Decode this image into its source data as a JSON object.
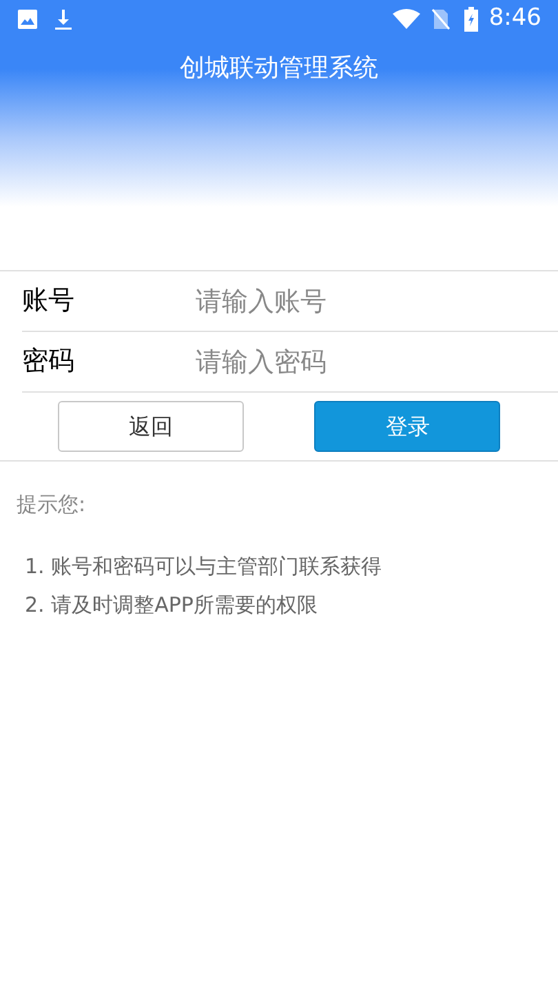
{
  "status_bar": {
    "time": "8:46"
  },
  "header": {
    "title": "创城联动管理系统"
  },
  "form": {
    "fields": [
      {
        "label": "账号",
        "placeholder": "请输入账号"
      },
      {
        "label": "密码",
        "placeholder": "请输入密码"
      }
    ]
  },
  "buttons": [
    {
      "label": "返回",
      "kind": "secondary"
    },
    {
      "label": "登录",
      "kind": "primary"
    }
  ],
  "tips": {
    "heading": "提示您:",
    "items": [
      "1. 账号和密码可以与主管部门联系获得",
      "2. 请及时调整APP所需要的权限"
    ]
  }
}
